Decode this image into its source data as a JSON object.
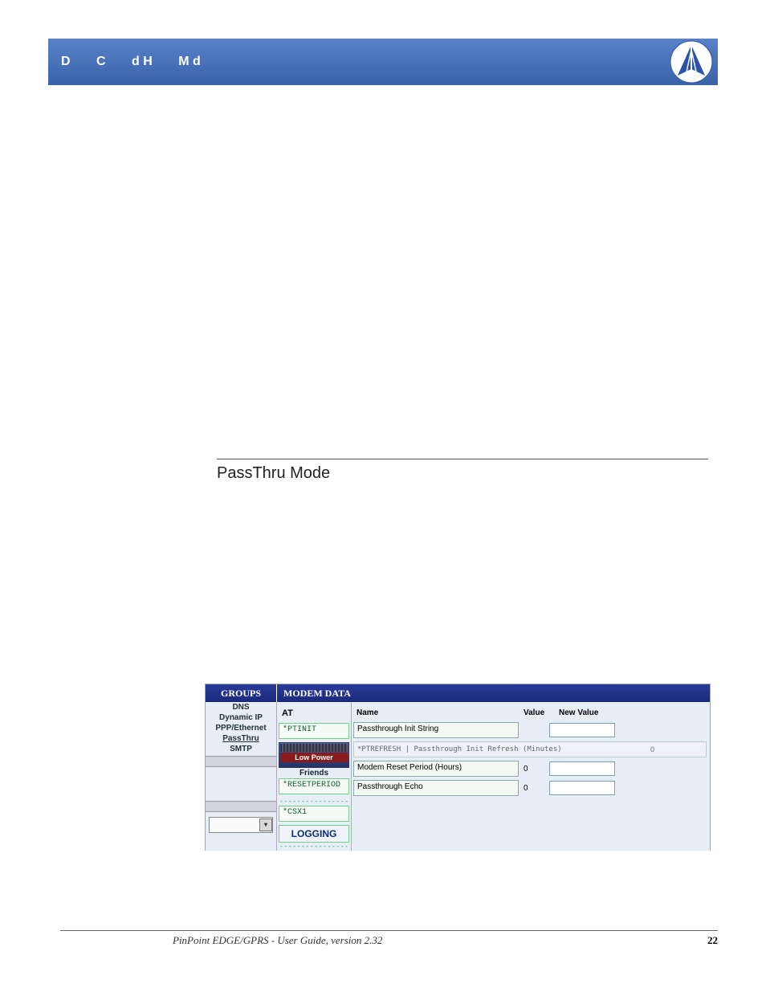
{
  "topbar": {
    "letters": [
      "D",
      "C",
      "d H",
      "M d"
    ]
  },
  "section": {
    "heading": "PassThru Mode"
  },
  "app": {
    "tab_groups": "GROUPS",
    "tab_modem": "MODEM DATA",
    "sidebar": {
      "items": [
        "DNS",
        "Dynamic IP",
        "PPP/Ethernet",
        "PassThru",
        "SMTP"
      ]
    },
    "midcol": {
      "header": "AT",
      "at_rows": [
        "*PTINIT",
        "",
        "*RESETPERIOD",
        "*CSX1"
      ],
      "banner_top": "Low Power",
      "friends": "Friends",
      "logging": "LOGGING"
    },
    "maincol": {
      "header_name": "Name",
      "header_value": "Value",
      "header_newvalue": "New Value",
      "rows": [
        {
          "name": "Passthrough Init String",
          "value": "",
          "newvalue": ""
        },
        {
          "name": "Modem Reset Period (Hours)",
          "value": "0",
          "newvalue": ""
        },
        {
          "name": "Passthrough Echo",
          "value": "0",
          "newvalue": ""
        }
      ],
      "weird_row": {
        "label": "*PTREFRESH | Passthrough Init Refresh (Minutes)",
        "value": "0"
      }
    }
  },
  "footer": {
    "text": "PinPoint EDGE/GPRS - User Guide, version 2.32",
    "page": "22"
  }
}
